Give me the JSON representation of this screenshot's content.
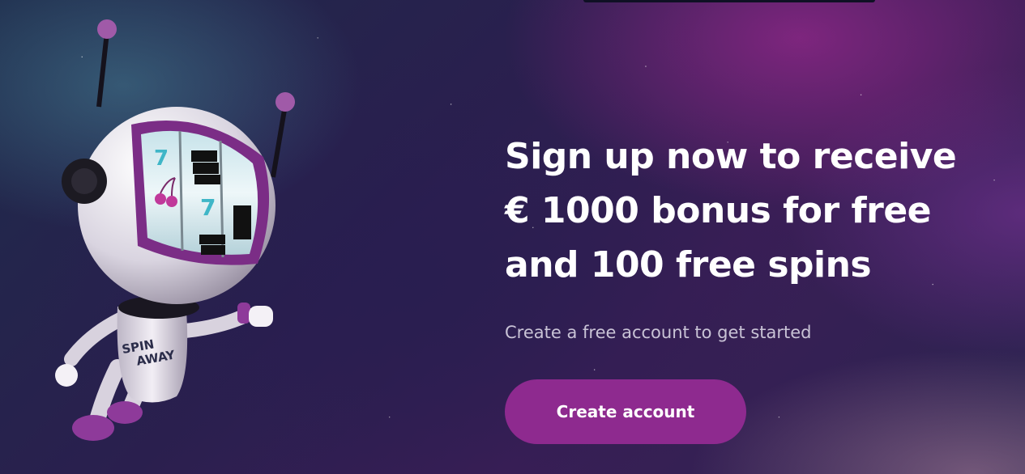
{
  "hero": {
    "headline_line1": "Sign up now to receive",
    "headline_line2": "€ 1000 bonus for free",
    "headline_line3": "and 100 free spins",
    "subtext": "Create a free account to get started",
    "cta_label": "Create account"
  },
  "mascot": {
    "icon": "slot-robot-mascot",
    "chest_logo": "SPIN AWAY",
    "reel_symbols": [
      "7",
      "BAR",
      "cherry",
      "7",
      "BAR"
    ]
  },
  "colors": {
    "cta_background": "#8e2a8f",
    "headline": "#ffffff",
    "subtext": "#c9c3d6",
    "mascot_accent": "#8e3a9a"
  }
}
